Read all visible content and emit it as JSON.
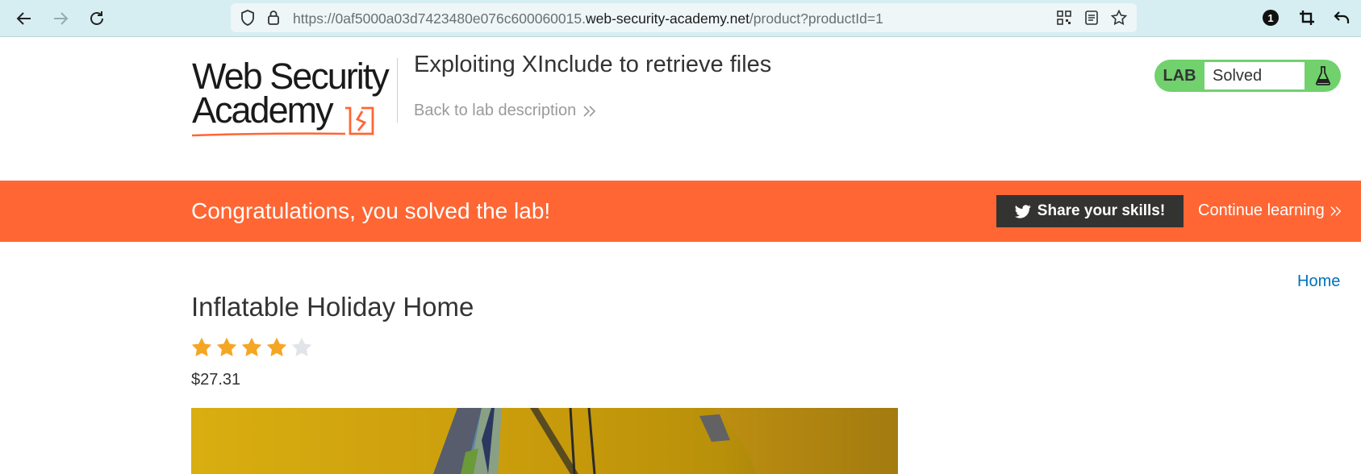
{
  "browser": {
    "url_prefix": "https://0af5000a03d7423480e076c600060015.",
    "url_host": "web-security-academy.net",
    "url_path": "/product?productId=1",
    "extension_badge": "1"
  },
  "header": {
    "logo_line1": "Web Security",
    "logo_line2": "Academy",
    "lab_title": "Exploiting XInclude to retrieve files",
    "back_link": "Back to lab description",
    "lab_label": "LAB",
    "lab_status": "Solved",
    "status_color": "#70d16d"
  },
  "banner": {
    "message": "Congratulations, you solved the lab!",
    "share_label": "Share your skills!",
    "continue_label": "Continue learning",
    "color": "#ff6633"
  },
  "product": {
    "home_link": "Home",
    "title": "Inflatable Holiday Home",
    "rating": 4,
    "rating_max": 5,
    "price": "$27.31"
  }
}
